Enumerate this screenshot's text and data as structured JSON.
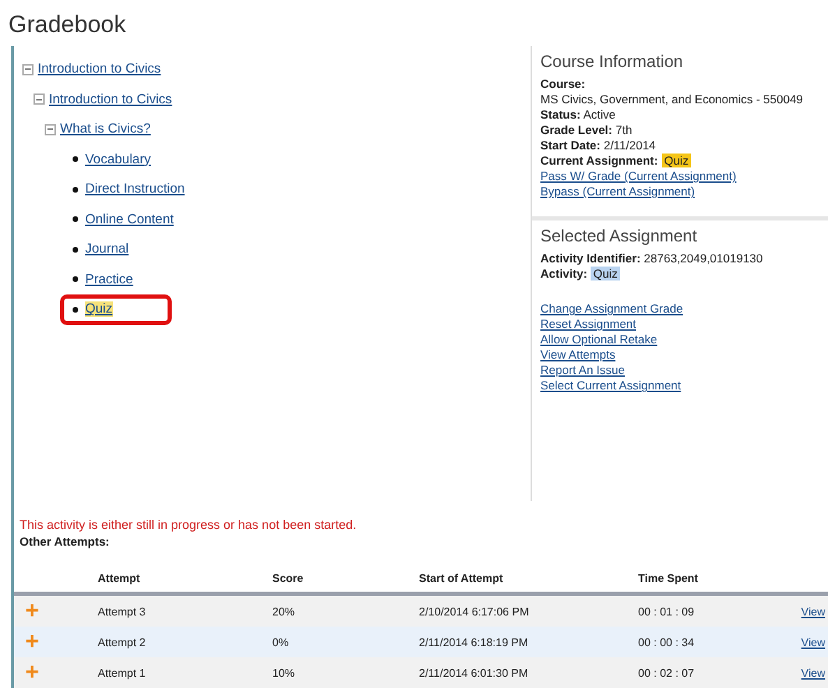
{
  "title": "Gradebook",
  "tree": [
    {
      "label": "Introduction to Civics",
      "expanded": true,
      "children": [
        {
          "label": "Introduction to Civics",
          "expanded": true,
          "children": [
            {
              "label": "What is Civics?",
              "expanded": true,
              "children": [
                {
                  "label": "Vocabulary",
                  "selected": false
                },
                {
                  "label": "Direct Instruction",
                  "selected": false
                },
                {
                  "label": "Online Content",
                  "selected": false
                },
                {
                  "label": "Journal",
                  "selected": false
                },
                {
                  "label": "Practice",
                  "selected": false
                },
                {
                  "label": "Quiz",
                  "selected": true
                }
              ]
            }
          ]
        }
      ]
    }
  ],
  "course_info": {
    "heading": "Course Information",
    "lines": [
      "**Course:**",
      "MS Civics, Government, and Economics - 550049",
      "**Status:** Active",
      "**Grade Level:** 7th",
      "**Start Date:** 2/11/2014"
    ],
    "current_label": "Current Assignment:",
    "current_value": "Quiz",
    "links": [
      "Pass W/ Grade (Current Assignment)",
      "Bypass (Current Assignment)"
    ]
  },
  "selected_assignment": {
    "heading": "Selected Assignment",
    "identifier": "**Activity Identifier:** 28763,2049,01019130",
    "activity_label": "Activity:",
    "activity_value": "Quiz",
    "links": [
      "Change Assignment Grade",
      "Reset Assignment",
      "Allow Optional Retake",
      "View Attempts",
      "Report An Issue",
      "Select Current Assignment"
    ]
  },
  "message": "This activity is either still in progress or has not been started.",
  "attempts_heading": "Other Attempts:",
  "table": {
    "columns": [
      "Attempt",
      "Score",
      "Start of Attempt",
      "Time Spent"
    ],
    "rows": [
      {
        "icon": "+",
        "cells": [
          "Attempt 3",
          "20%",
          "2/10/2014 6:17:06 PM",
          "00 : 01 : 09"
        ],
        "link": "View"
      },
      {
        "icon": "+",
        "cells": [
          "Attempt 2",
          "0%",
          "2/11/2014 6:18:19 PM",
          "00 : 00 : 34"
        ],
        "link": "View"
      },
      {
        "icon": "+",
        "cells": [
          "Attempt 1",
          "10%",
          "2/11/2014 6:01:30 PM",
          "00 : 02 : 07"
        ],
        "link": "View"
      }
    ]
  }
}
